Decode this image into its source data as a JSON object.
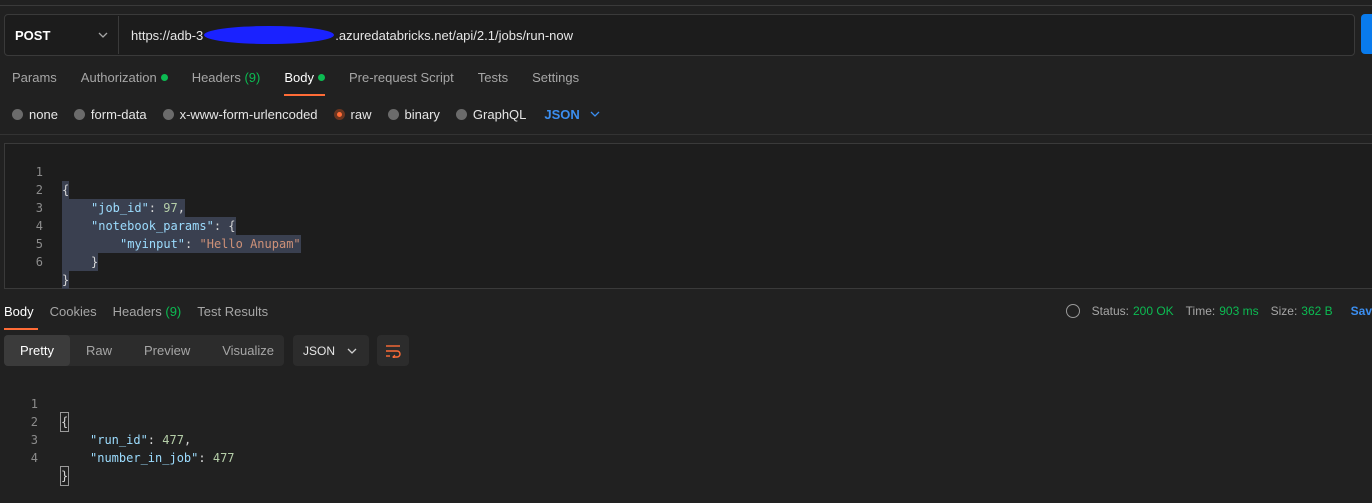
{
  "request": {
    "method": "POST",
    "url_prefix": "https://adb-3",
    "url_suffix": ".azuredatabricks.net/api/2.1/jobs/run-now"
  },
  "request_tabs": [
    {
      "label": "Params"
    },
    {
      "label": "Authorization",
      "dot": true
    },
    {
      "label": "Headers",
      "count": "(9)"
    },
    {
      "label": "Body",
      "dot": true,
      "active": true
    },
    {
      "label": "Pre-request Script"
    },
    {
      "label": "Tests"
    },
    {
      "label": "Settings"
    }
  ],
  "body_types": [
    "none",
    "form-data",
    "x-www-form-urlencoded",
    "raw",
    "binary",
    "GraphQL"
  ],
  "body_type_selected": "raw",
  "body_format": "JSON",
  "request_body": {
    "line_numbers": [
      "1",
      "2",
      "3",
      "4",
      "5",
      "6"
    ],
    "lines": [
      "{",
      "\"job_id\": 97,",
      "\"notebook_params\": {",
      "\"myinput\": \"Hello Anupam\"",
      "}",
      "}"
    ]
  },
  "response_tabs": [
    {
      "label": "Body",
      "active": true
    },
    {
      "label": "Cookies"
    },
    {
      "label": "Headers",
      "count": "(9)"
    },
    {
      "label": "Test Results"
    }
  ],
  "status": {
    "status_label": "Status:",
    "status_value": "200 OK",
    "time_label": "Time:",
    "time_value": "903 ms",
    "size_label": "Size:",
    "size_value": "362 B",
    "save_label": "Sav"
  },
  "view_modes": [
    "Pretty",
    "Raw",
    "Preview",
    "Visualize"
  ],
  "response_format": "JSON",
  "response_body": {
    "line_numbers": [
      "1",
      "2",
      "3",
      "4"
    ],
    "lines": [
      "{",
      "\"run_id\": 477,",
      "\"number_in_job\": 477",
      "}"
    ]
  },
  "colors": {
    "accent": "#ff6c37",
    "link_blue": "#3b8ef0",
    "success_green": "#0cbb52"
  }
}
